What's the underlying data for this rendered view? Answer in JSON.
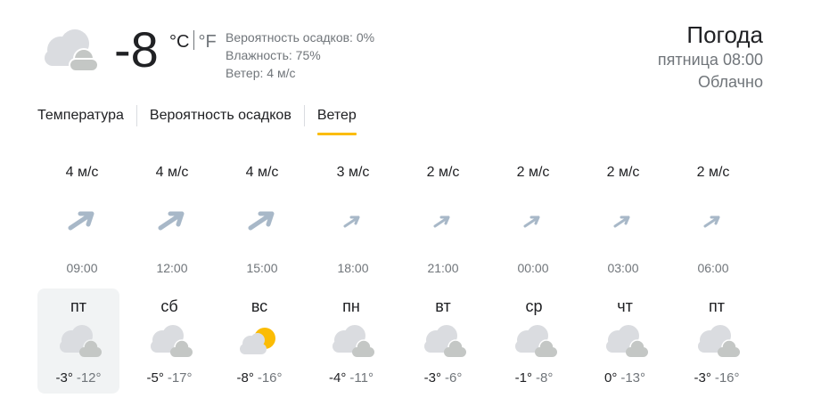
{
  "current": {
    "icon": "cloudy-icon",
    "temp": "-8",
    "unit_c": "°C",
    "unit_f": "°F",
    "precip": "Вероятность осадков: 0%",
    "humidity": "Влажность: 75%",
    "wind": "Ветер: 4 м/с"
  },
  "header": {
    "title": "Погода",
    "datetime": "пятница 08:00",
    "condition": "Облачно"
  },
  "tabs": [
    {
      "label": "Температура",
      "active": false
    },
    {
      "label": "Вероятность осадков",
      "active": false
    },
    {
      "label": "Ветер",
      "active": true
    }
  ],
  "wind_forecast": [
    {
      "speed": "4 м/с",
      "time": "09:00"
    },
    {
      "speed": "4 м/с",
      "time": "12:00"
    },
    {
      "speed": "4 м/с",
      "time": "15:00"
    },
    {
      "speed": "3 м/с",
      "time": "18:00"
    },
    {
      "speed": "2 м/с",
      "time": "21:00"
    },
    {
      "speed": "2 м/с",
      "time": "00:00"
    },
    {
      "speed": "2 м/с",
      "time": "03:00"
    },
    {
      "speed": "2 м/с",
      "time": "06:00"
    }
  ],
  "daily": [
    {
      "day": "пт",
      "high": "-3°",
      "low": "-12°",
      "icon": "cloudy-icon",
      "selected": true
    },
    {
      "day": "сб",
      "high": "-5°",
      "low": "-17°",
      "icon": "cloudy-icon",
      "selected": false
    },
    {
      "day": "вс",
      "high": "-8°",
      "low": "-16°",
      "icon": "partly-sunny-icon",
      "selected": false
    },
    {
      "day": "пн",
      "high": "-4°",
      "low": "-11°",
      "icon": "cloudy-icon",
      "selected": false
    },
    {
      "day": "вт",
      "high": "-3°",
      "low": "-6°",
      "icon": "cloudy-icon",
      "selected": false
    },
    {
      "day": "ср",
      "high": "-1°",
      "low": "-8°",
      "icon": "cloudy-icon",
      "selected": false
    },
    {
      "day": "чт",
      "high": "0°",
      "low": "-13°",
      "icon": "cloudy-icon",
      "selected": false
    },
    {
      "day": "пт",
      "high": "-3°",
      "low": "-16°",
      "icon": "cloudy-icon",
      "selected": false
    }
  ],
  "colors": {
    "accent": "#fbbc04",
    "cloud": "#dadce0",
    "sun": "#fbbc04",
    "arrow": "#a8b8c8",
    "muted": "#70757a"
  }
}
